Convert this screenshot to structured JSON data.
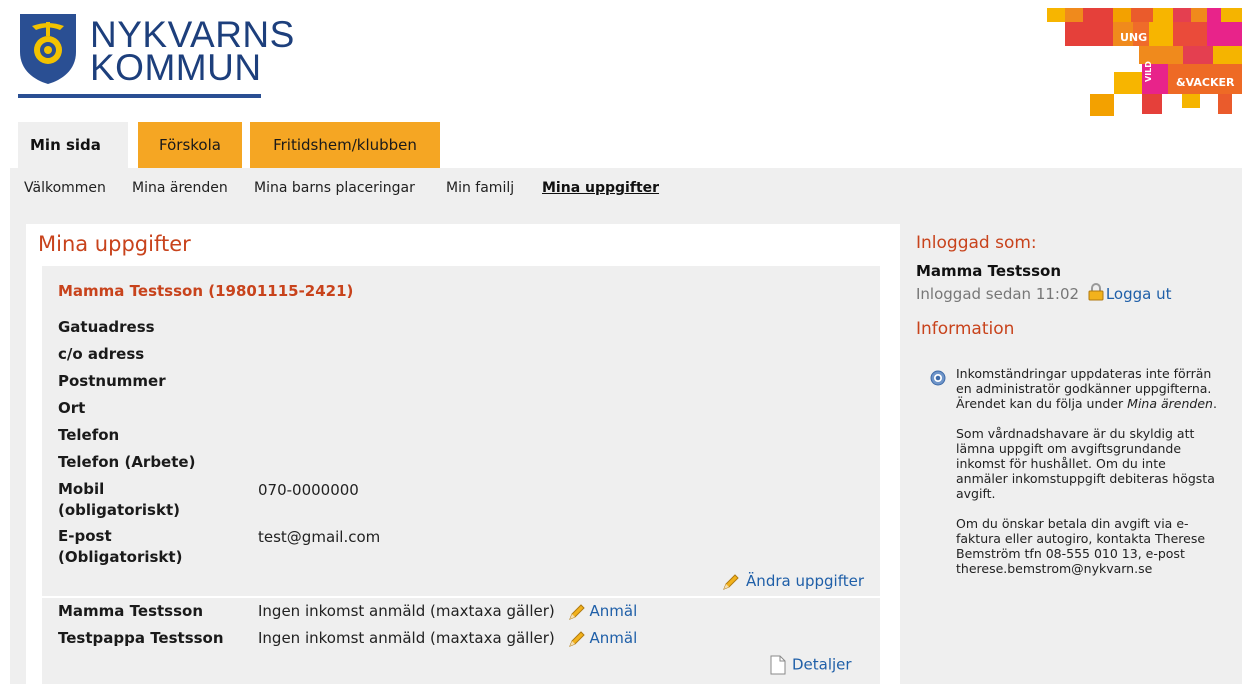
{
  "header": {
    "logo_line1": "NYKVARNS",
    "logo_line2": "KOMMUN",
    "brand": {
      "word1": "UNG",
      "word2": "VILD",
      "word3": "&VACKER"
    }
  },
  "tabs": [
    {
      "label": "Min sida",
      "active": true
    },
    {
      "label": "Förskola",
      "active": false
    },
    {
      "label": "Fritidshem/klubben",
      "active": false
    }
  ],
  "subnav": [
    {
      "label": "Välkommen"
    },
    {
      "label": "Mina ärenden"
    },
    {
      "label": "Mina barns placeringar"
    },
    {
      "label": "Min familj"
    },
    {
      "label": "Mina uppgifter",
      "current": true
    }
  ],
  "main": {
    "title": "Mina uppgifter",
    "person_name": "Mamma Testsson (19801115-2421)",
    "fields": [
      {
        "label": "Gatuadress",
        "value": ""
      },
      {
        "label": "c/o adress",
        "value": ""
      },
      {
        "label": "Postnummer",
        "value": ""
      },
      {
        "label": "Ort",
        "value": ""
      },
      {
        "label": "Telefon",
        "value": ""
      },
      {
        "label": "Telefon (Arbete)",
        "value": ""
      },
      {
        "label": "Mobil\n(obligatoriskt)",
        "value": "070-0000000"
      },
      {
        "label": "E-post\n(Obligatoriskt)",
        "value": "test@gmail.com"
      }
    ],
    "edit_label": "Ändra uppgifter",
    "income": [
      {
        "name": "Mamma Testsson",
        "text": "Ingen inkomst anmäld (maxtaxa gäller)",
        "action": "Anmäl"
      },
      {
        "name": "Testpappa Testsson",
        "text": "Ingen inkomst anmäld (maxtaxa gäller)",
        "action": "Anmäl"
      }
    ],
    "details_label": "Detaljer"
  },
  "sidebar": {
    "logged_heading": "Inloggad som:",
    "logged_name": "Mamma Testsson",
    "logged_since": "Inloggad sedan 11:02",
    "logout_label": "Logga ut",
    "info_heading": "Information",
    "info_p1a": "Inkomständringar uppdateras inte förrän en administratör godkänner uppgifterna. Ärendet kan du följa under ",
    "info_p1_em": "Mina ärenden",
    "info_p1b": ".",
    "info_p2": "Som vårdnadshavare är du skyldig att lämna uppgift om avgiftsgrundande inkomst för hushållet. Om du inte anmäler inkomstuppgift debiteras högsta avgift.",
    "info_p3": "Om du önskar betala din avgift via e-faktura eller autogiro, kontakta Therese Bemström tfn 08-555 010 13, e-post therese.bemstrom@nykvarn.se"
  },
  "colors": {
    "accent": "#c8431c",
    "tab_orange": "#f5a623",
    "link": "#1f5fa8",
    "navy": "#1d3f7c"
  }
}
